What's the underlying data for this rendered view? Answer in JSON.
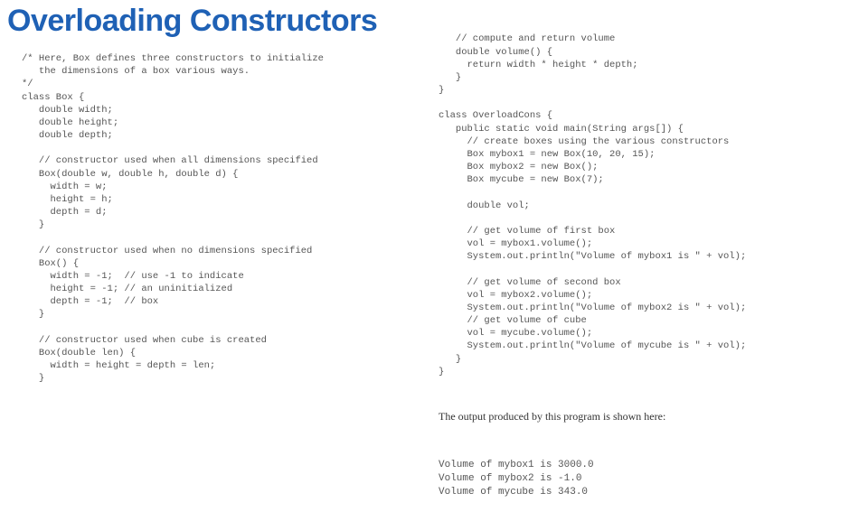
{
  "title": "Overloading Constructors",
  "left_code": "/* Here, Box defines three constructors to initialize\n   the dimensions of a box various ways.\n*/\nclass Box {\n   double width;\n   double height;\n   double depth;\n\n   // constructor used when all dimensions specified\n   Box(double w, double h, double d) {\n     width = w;\n     height = h;\n     depth = d;\n   }\n\n   // constructor used when no dimensions specified\n   Box() {\n     width = -1;  // use -1 to indicate\n     height = -1; // an uninitialized\n     depth = -1;  // box\n   }\n\n   // constructor used when cube is created\n   Box(double len) {\n     width = height = depth = len;\n   }",
  "right_code": "   // compute and return volume\n   double volume() {\n     return width * height * depth;\n   }\n}\n\nclass OverloadCons {\n   public static void main(String args[]) {\n     // create boxes using the various constructors\n     Box mybox1 = new Box(10, 20, 15);\n     Box mybox2 = new Box();\n     Box mycube = new Box(7);\n\n     double vol;\n\n     // get volume of first box\n     vol = mybox1.volume();\n     System.out.println(\"Volume of mybox1 is \" + vol);\n\n     // get volume of second box\n     vol = mybox2.volume();\n     System.out.println(\"Volume of mybox2 is \" + vol);\n     // get volume of cube\n     vol = mycube.volume();\n     System.out.println(\"Volume of mycube is \" + vol);\n   }\n}",
  "prose": "The output produced by this program is shown here:",
  "output_lines": "Volume of mybox1 is 3000.0\nVolume of mybox2 is -1.0\nVolume of mycube is 343.0"
}
